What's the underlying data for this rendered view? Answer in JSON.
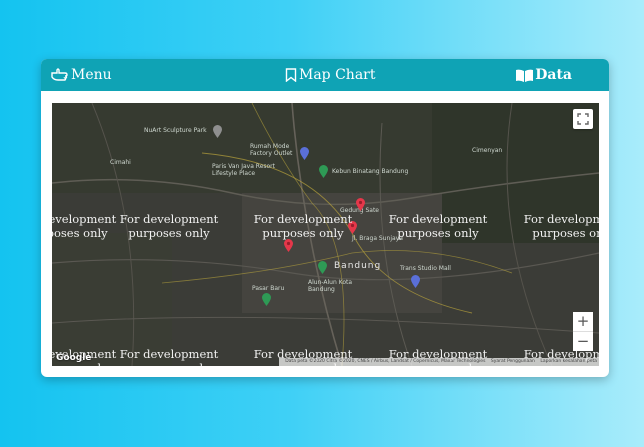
{
  "nav": {
    "menu_label": "Menu",
    "title": "Map Chart",
    "data_label": "Data"
  },
  "map": {
    "watermark": "For development purposes only",
    "city_label": "Bandung",
    "pois": {
      "sculpture_park": "NuArt Sculpture Park",
      "humaniora": "Rumah Mode Factory Outlet",
      "paris_van_java": "Paris Van Java Resort Lifestyle Place",
      "kebun_binatang": "Kebun Binatang Bandung",
      "gedung": "Gedung Sate",
      "cimenyan": "Cimenyan",
      "braga": "Jl. Braga Sunjaya",
      "trans_studio": "Trans Studio Mall",
      "alun_alun": "Alun-Alun Kota Bandung",
      "pasar": "Pasar Baru",
      "cimahi": "Cimahi"
    },
    "logo": "Google",
    "attribution": {
      "data": "Data peta ©2020 Citra ©2020, CNES / Airbus, Landsat / Copernicus, Maxar Technologies",
      "terms": "Syarat Penggunaan",
      "report": "Laporkan kesalahan peta"
    },
    "zoom_in": "+",
    "zoom_out": "−"
  }
}
